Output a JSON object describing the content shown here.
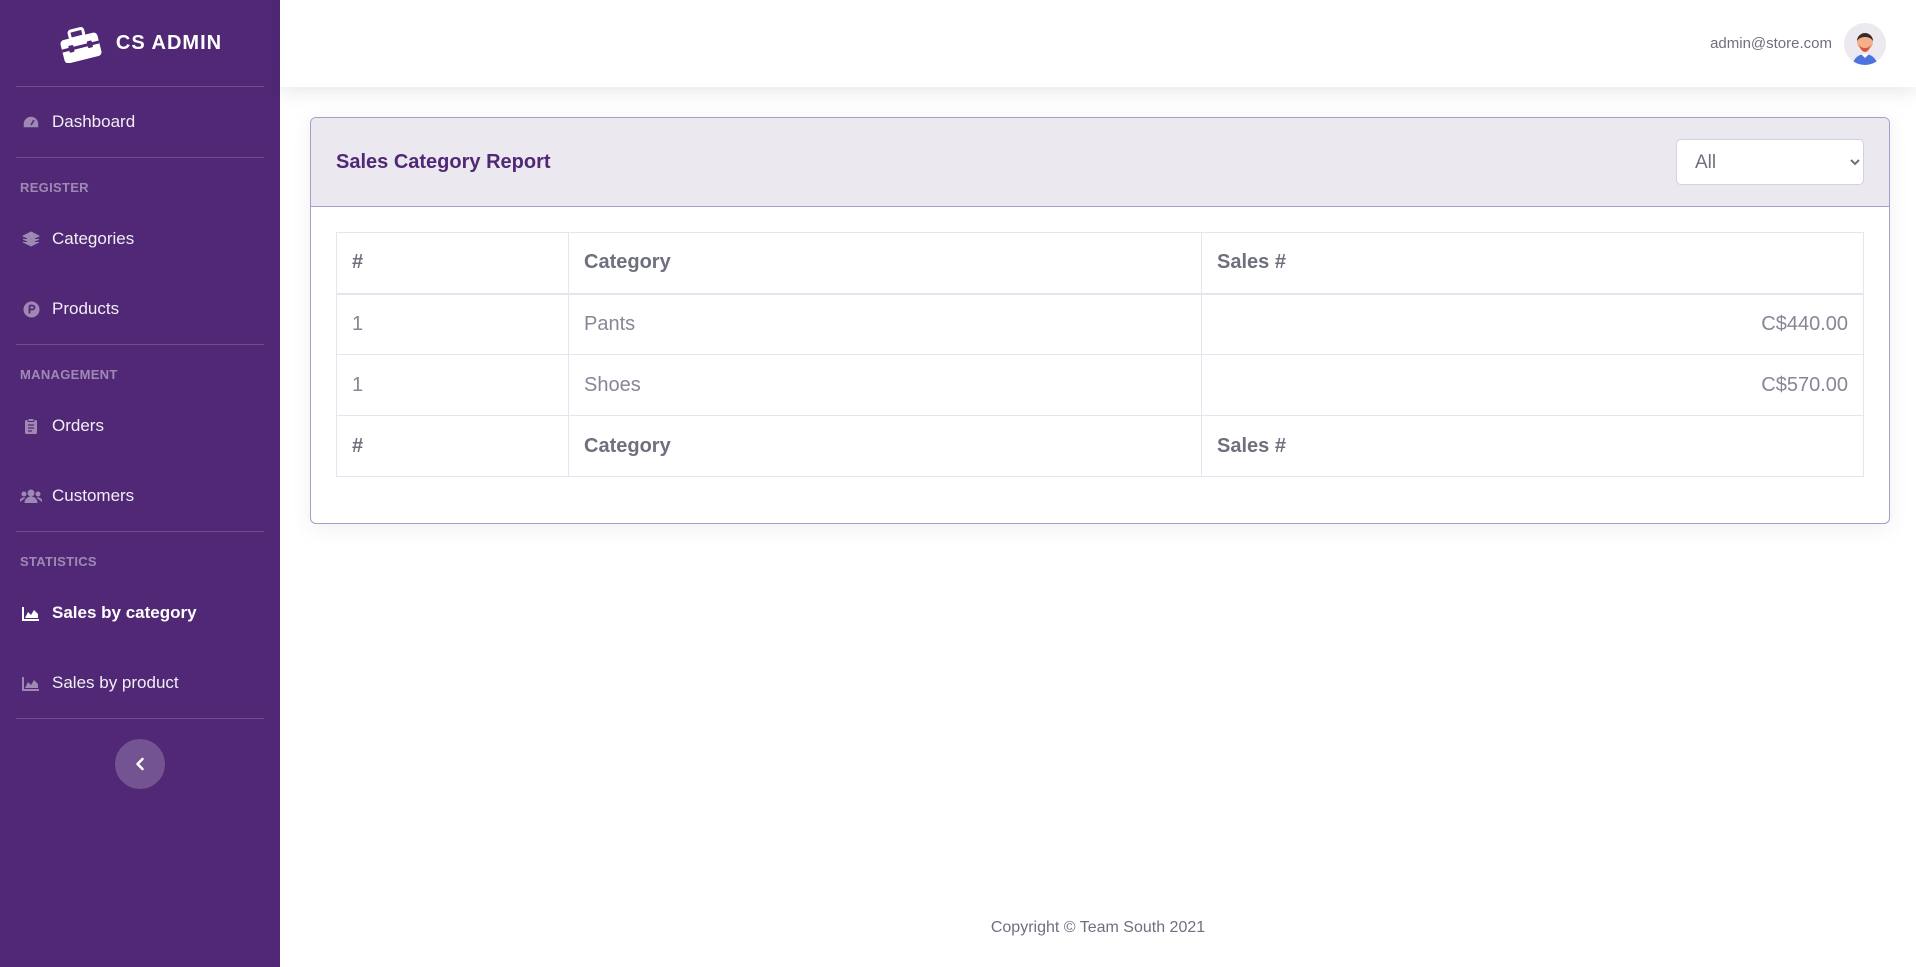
{
  "brand": {
    "name": "CS ADMIN",
    "logo_icon": "toolbox-icon"
  },
  "sidebar": {
    "dashboard": {
      "label": "Dashboard",
      "icon": "gauge-icon"
    },
    "sections": {
      "register": "REGISTER",
      "management": "MANAGEMENT",
      "statistics": "STATISTICS"
    },
    "categories": {
      "label": "Categories",
      "icon": "layers-icon"
    },
    "products": {
      "label": "Products",
      "icon": "product-hunt-icon"
    },
    "orders": {
      "label": "Orders",
      "icon": "clipboard-icon"
    },
    "customers": {
      "label": "Customers",
      "icon": "users-icon"
    },
    "sales_by_category": {
      "label": "Sales by category",
      "icon": "area-chart-icon",
      "active": true
    },
    "sales_by_product": {
      "label": "Sales by product",
      "icon": "area-chart-icon"
    },
    "toggle_icon": "chevron-left-icon"
  },
  "topbar": {
    "user_email": "admin@store.com",
    "avatar_icon": "user-avatar"
  },
  "report": {
    "title": "Sales Category Report",
    "filter": {
      "selected": "All",
      "options": [
        "All"
      ]
    },
    "table": {
      "headers": [
        "#",
        "Category",
        "Sales #"
      ],
      "rows": [
        {
          "num": "1",
          "category": "Pants",
          "sales": "C$440.00"
        },
        {
          "num": "1",
          "category": "Shoes",
          "sales": "C$570.00"
        }
      ],
      "footers": [
        "#",
        "Category",
        "Sales #"
      ]
    }
  },
  "footer": {
    "copyright": "Copyright © Team South 2021"
  },
  "colors": {
    "sidebar_bg": "#502876",
    "accent": "#502876",
    "card_header_bg": "#ebe8f0",
    "card_border": "#a99cc6"
  }
}
